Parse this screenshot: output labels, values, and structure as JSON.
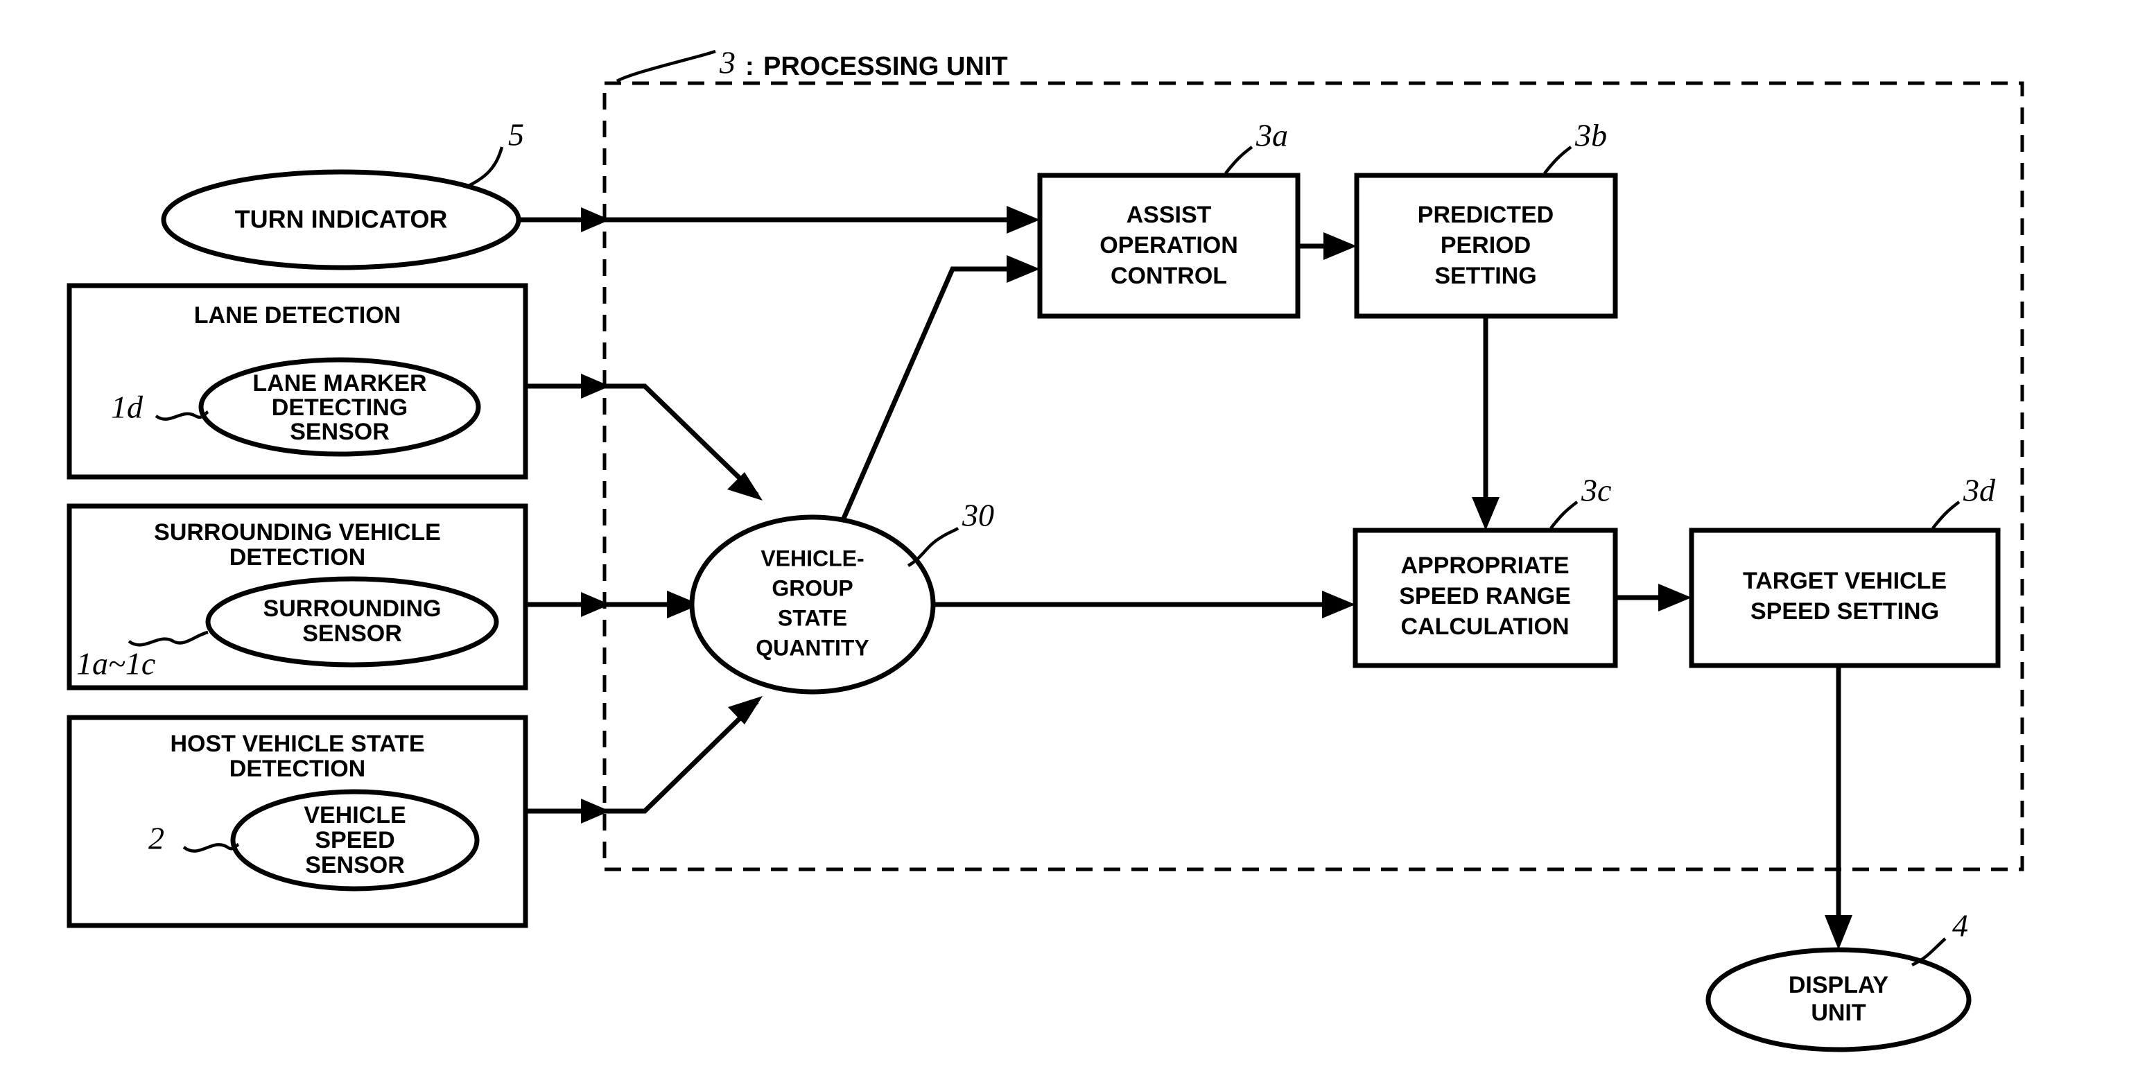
{
  "figure": {
    "title_ref": "3",
    "title_sep": ":",
    "title_text": "PROCESSING UNIT"
  },
  "nodes": {
    "turn_indicator": {
      "label": "TURN INDICATOR",
      "ref": "5",
      "shape": "ellipse"
    },
    "lane_detection": {
      "title": "LANE DETECTION",
      "sensor_line1": "LANE MARKER",
      "sensor_line2": "DETECTING",
      "sensor_line3": "SENSOR",
      "ref": "1d",
      "shape": "box-with-ellipse"
    },
    "surrounding_detection": {
      "title_line1": "SURROUNDING VEHICLE",
      "title_line2": "DETECTION",
      "sensor_line1": "SURROUNDING",
      "sensor_line2": "SENSOR",
      "ref": "1a~1c",
      "shape": "box-with-ellipse"
    },
    "host_vehicle_detection": {
      "title_line1": "HOST VEHICLE STATE",
      "title_line2": "DETECTION",
      "sensor_line1": "VEHICLE",
      "sensor_line2": "SPEED",
      "sensor_line3": "SENSOR",
      "ref": "2",
      "shape": "box-with-ellipse"
    },
    "state_quantity": {
      "line1": "VEHICLE-",
      "line2": "GROUP",
      "line3": "STATE",
      "line4": "QUANTITY",
      "ref": "30",
      "shape": "ellipse"
    },
    "assist_operation_control": {
      "line1": "ASSIST",
      "line2": "OPERATION",
      "line3": "CONTROL",
      "ref": "3a",
      "shape": "box"
    },
    "predicted_period_setting": {
      "line1": "PREDICTED",
      "line2": "PERIOD",
      "line3": "SETTING",
      "ref": "3b",
      "shape": "box"
    },
    "appropriate_speed_range": {
      "line1": "APPROPRIATE",
      "line2": "SPEED RANGE",
      "line3": "CALCULATION",
      "ref": "3c",
      "shape": "box"
    },
    "target_vehicle_speed": {
      "line1": "TARGET VEHICLE",
      "line2": "SPEED SETTING",
      "ref": "3d",
      "shape": "box"
    },
    "display_unit": {
      "line1": "DISPLAY",
      "line2": "UNIT",
      "ref": "4",
      "shape": "ellipse"
    }
  },
  "colors": {
    "stroke": "#000000",
    "fill": "#ffffff"
  }
}
